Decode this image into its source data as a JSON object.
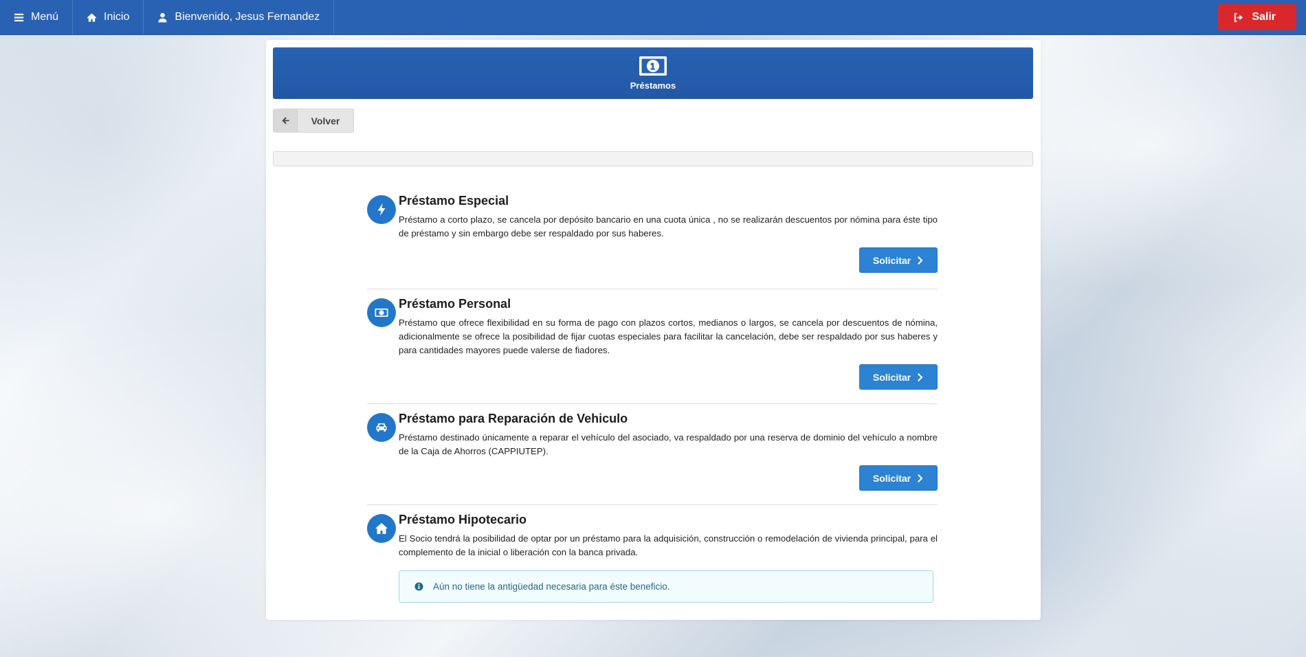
{
  "navbar": {
    "menu_label": "Menú",
    "home_label": "Inicio",
    "welcome_label": "Bienvenido, Jesus Fernandez",
    "logout_label": "Salir",
    "colors": {
      "bar": "#2962b3",
      "logout": "#d9282c"
    }
  },
  "header": {
    "title": "Préstamos",
    "icon": "money-bill-icon"
  },
  "back_button": {
    "label": "Volver"
  },
  "loans": [
    {
      "icon": "bolt-icon",
      "title": "Préstamo Especial",
      "description": "Préstamo a corto plazo, se cancela por depósito bancario en una cuota única , no se realizarán descuentos por nómina para éste tipo de préstamo y sin embargo debe ser respaldado por sus haberes.",
      "button_label": "Solicitar"
    },
    {
      "icon": "money-bill-icon",
      "title": "Préstamo Personal",
      "description": "Préstamo que ofrece flexibilidad en su forma de pago con plazos cortos, medianos o largos, se cancela por descuentos de nómina, adicionalmente se ofrece la posibilidad de fijar cuotas especiales para facilitar la cancelación, debe ser respaldado por sus haberes y para cantidades mayores puede valerse de fiadores.",
      "button_label": "Solicitar"
    },
    {
      "icon": "car-icon",
      "title": "Préstamo para Reparación de Vehiculo",
      "description": "Préstamo destinado únicamente a reparar el vehículo del asociado, va respaldado por una reserva de dominio del vehículo a nombre de la Caja de Ahorros (CAPPIUTEP).",
      "button_label": "Solicitar"
    },
    {
      "icon": "home-icon",
      "title": "Préstamo Hipotecario",
      "description": "El Socio tendrá la posibilidad de optar por un préstamo para la adquisición, construcción o remodelación de vivienda principal, para el complemento de la inicial o liberación con la banca privada.",
      "notice": "Aún no tiene la antigüedad necesaria para éste beneficio."
    }
  ],
  "colors": {
    "accent": "#2c82d3",
    "icon_circle": "#2377c9",
    "info_text": "#256a86"
  }
}
